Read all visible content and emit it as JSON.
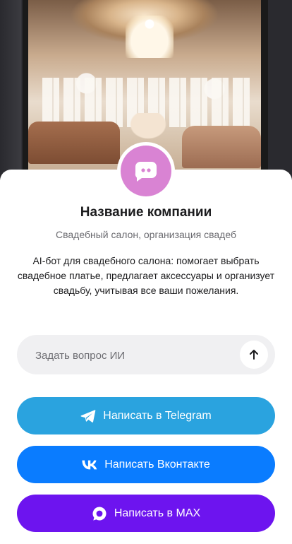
{
  "company": {
    "name": "Название компании",
    "category": "Свадебный салон, организация свадеб",
    "description": "AI-бот для свадебного салона: помогает выбрать свадебное платье, предлагает аксессуары и организует свадьбу, учитывая все ваши пожелания."
  },
  "ask": {
    "placeholder": "Задать вопрос ИИ"
  },
  "actions": {
    "telegram_label": "Написать в Telegram",
    "vk_label": "Написать Вконтакте",
    "max_label": "Написать в MAX"
  },
  "colors": {
    "avatar": "#d983d3",
    "telegram": "#2aa3df",
    "vk": "#0a7cff",
    "max": "#6d14ef",
    "field": "#f0f0f2"
  },
  "icons": {
    "avatar": "chat-bubble-icon",
    "send": "arrow-up-icon",
    "telegram": "telegram-icon",
    "vk": "vk-icon",
    "max": "max-icon"
  }
}
